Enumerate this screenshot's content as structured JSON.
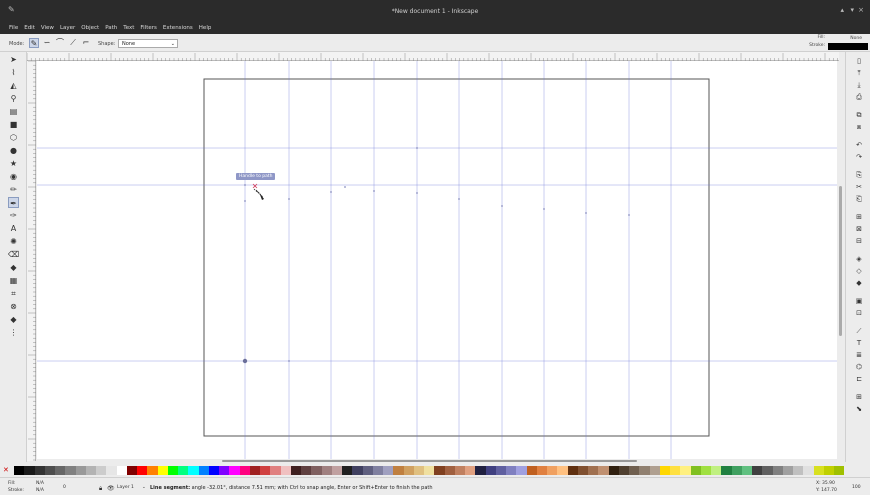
{
  "window": {
    "title": "*New document 1 - Inkscape",
    "app_icon": "inkscape-icon"
  },
  "menu": [
    "File",
    "Edit",
    "View",
    "Layer",
    "Object",
    "Path",
    "Text",
    "Filters",
    "Extensions",
    "Help"
  ],
  "tool_controls": {
    "mode_label": "Mode:",
    "shape_label": "Shape:",
    "shape_value": "None",
    "fill_label": "Fill:",
    "fill_value": "None",
    "stroke_label": "Stroke:"
  },
  "canvas": {
    "tooltip": "Handle to path"
  },
  "statusbar": {
    "fill_label": "Fill:",
    "fill_value": "N/A",
    "stroke_label": "Stroke:",
    "stroke_value": "N/A",
    "opacity_value": "0",
    "layer_value": "Layer 1",
    "message_tool": "Line segment:",
    "message_text": " angle -32.01°, distance 7.51 mm; with Ctrl to snap angle, Enter or Shift+Enter to finish the path",
    "cursor_x": "X: 35.90",
    "cursor_y": "Y: 147.70",
    "zoom": "100"
  },
  "colors": {
    "titlebar": "#2b2b2b",
    "guide": "#6a74d8",
    "page_border": "#555555",
    "palette": [
      "#000000",
      "#1a1a1a",
      "#333333",
      "#4d4d4d",
      "#666666",
      "#808080",
      "#999999",
      "#b3b3b3",
      "#cccccc",
      "#e6e6e6",
      "#ffffff",
      "#800000",
      "#ff0000",
      "#ff8000",
      "#ffff00",
      "#00ff00",
      "#00ff80",
      "#00ffff",
      "#0080ff",
      "#0000ff",
      "#8000ff",
      "#ff00ff",
      "#ff0080",
      "#a02020",
      "#d04040",
      "#e08080",
      "#f0c0c0",
      "#402020",
      "#604040",
      "#806060",
      "#a08080",
      "#c0a0a0",
      "#202020",
      "#404060",
      "#606080",
      "#8080a0",
      "#a0a0c0",
      "#c08040",
      "#d0a060",
      "#e0c080",
      "#f0e0a0",
      "#804020",
      "#a06040",
      "#c08060",
      "#e0a080",
      "#202040",
      "#404080",
      "#6060a0",
      "#8080c0",
      "#a0a0e0",
      "#c06020",
      "#e08040",
      "#f0a060",
      "#ffc080",
      "#603010",
      "#805030",
      "#a07050",
      "#c09070",
      "#302010",
      "#504030",
      "#706050",
      "#908070",
      "#b0a090",
      "#ffd700",
      "#ffe040",
      "#fff080",
      "#80c020",
      "#a0e040",
      "#c0f080",
      "#208040",
      "#40a060",
      "#60c080",
      "#404040",
      "#606060",
      "#808080",
      "#a0a0a0",
      "#c0c0c0",
      "#e0e0e0",
      "#d8e020",
      "#c0d000",
      "#a0c000"
    ]
  }
}
